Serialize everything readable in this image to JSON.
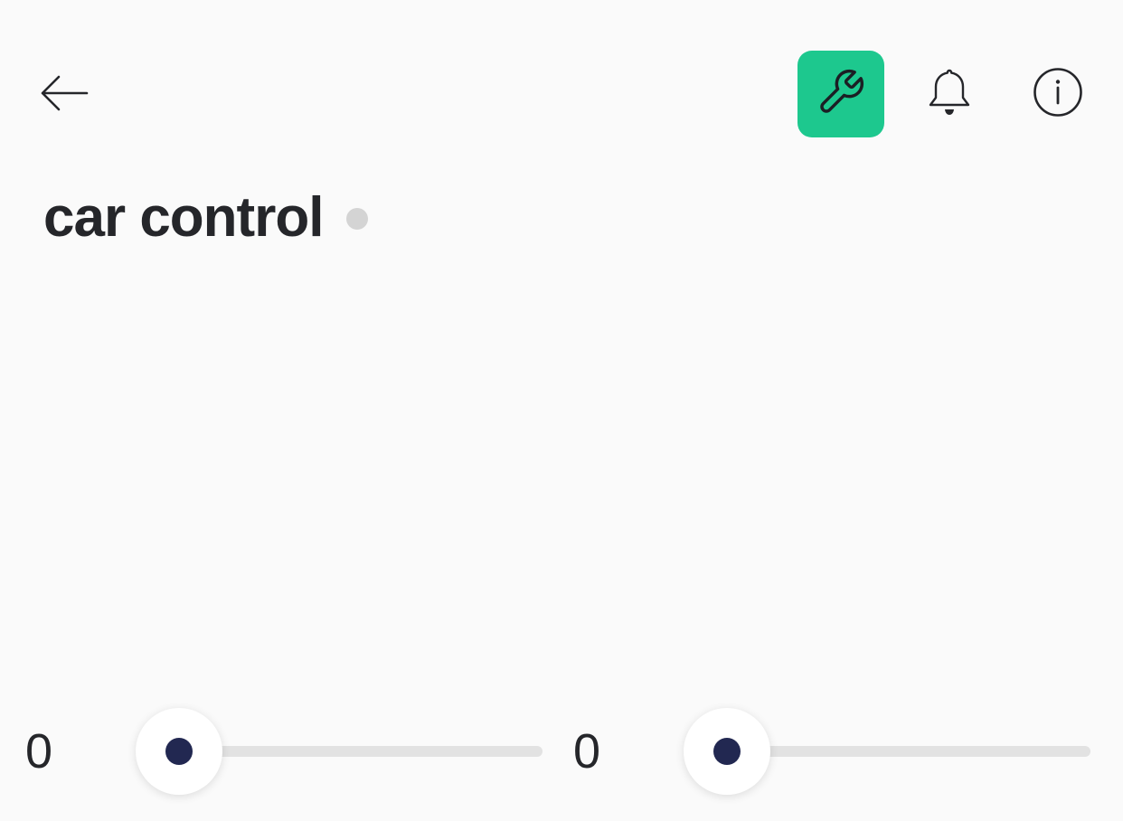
{
  "header": {
    "back_icon": "arrow-left-icon",
    "tool_icon": "wrench-icon",
    "bell_icon": "bell-icon",
    "info_icon": "info-circle-icon",
    "tool_button_color": "#1dc88e"
  },
  "page": {
    "title": "car control",
    "status_dot_color": "#d4d4d4"
  },
  "sliders": [
    {
      "value": "0",
      "level": 0
    },
    {
      "value": "0",
      "level": 0
    }
  ],
  "colors": {
    "thumb_dot": "#222851",
    "track": "#e2e2e2",
    "text": "#25262a"
  }
}
